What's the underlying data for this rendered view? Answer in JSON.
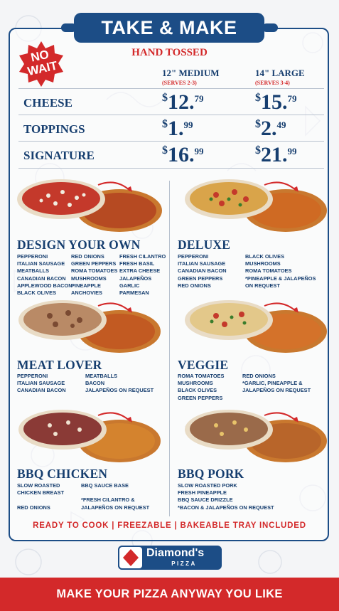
{
  "header": {
    "title": "TAKE & MAKE",
    "badge": "NO WAIT",
    "subtitle": "HAND TOSSED"
  },
  "sizes": [
    {
      "name": "12\" MEDIUM",
      "serves": "(SERVES 2-3)"
    },
    {
      "name": "14\" LARGE",
      "serves": "(SERVES 3-4)"
    }
  ],
  "prices": [
    {
      "label": "CHEESE",
      "medium": {
        "cur": "$",
        "whole": "12.",
        "cents": "79"
      },
      "large": {
        "cur": "$",
        "whole": "15.",
        "cents": "79"
      }
    },
    {
      "label": "TOPPINGS",
      "medium": {
        "cur": "$",
        "whole": "1.",
        "cents": "99"
      },
      "large": {
        "cur": "$",
        "whole": "2.",
        "cents": "49"
      }
    },
    {
      "label": "SIGNATURE",
      "medium": {
        "cur": "$",
        "whole": "16.",
        "cents": "99"
      },
      "large": {
        "cur": "$",
        "whole": "21.",
        "cents": "99"
      }
    }
  ],
  "pizzas": {
    "design": {
      "title": "DESIGN YOUR OWN",
      "col1": [
        "PEPPERONI",
        "ITALIAN SAUSAGE",
        "MEATBALLS",
        "CANADIAN BACON",
        "APPLEWOOD BACON",
        "BLACK OLIVES"
      ],
      "col2": [
        "RED ONIONS",
        "GREEN PEPPERS",
        "ROMA TOMATOES",
        "MUSHROOMS",
        "PINEAPPLE",
        "ANCHOVIES"
      ],
      "col3": [
        "FRESH CILANTRO",
        "FRESH BASIL",
        "EXTRA CHEESE",
        "JALAPEÑOS",
        "GARLIC",
        "PARMESAN"
      ]
    },
    "deluxe": {
      "title": "DELUXE",
      "col1": [
        "PEPPERONI",
        "ITALIAN SAUSAGE",
        "CANADIAN BACON",
        "GREEN PEPPERS",
        "RED ONIONS"
      ],
      "col2": [
        "BLACK OLIVES",
        "MUSHROOMS",
        "ROMA TOMATOES",
        "*PINEAPPLE & JALAPEÑOS",
        "ON REQUEST"
      ]
    },
    "meat": {
      "title": "MEAT LOVER",
      "col1": [
        "PEPPERONI",
        "ITALIAN SAUSAGE",
        "CANADIAN BACON"
      ],
      "col2": [
        "MEATBALLS",
        "BACON",
        "JALAPEÑOS ON REQUEST"
      ]
    },
    "veggie": {
      "title": "VEGGIE",
      "col1": [
        "ROMA TOMATOES",
        "MUSHROOMS",
        "BLACK OLIVES",
        "GREEN PEPPERS"
      ],
      "col2": [
        "RED ONIONS",
        "*GARLIC, PINEAPPLE &",
        "JALAPEÑOS ON REQUEST"
      ]
    },
    "bbqchicken": {
      "title": "BBQ CHICKEN",
      "col1": [
        "SLOW ROASTED",
        "CHICKEN BREAST",
        "",
        "RED ONIONS"
      ],
      "col2": [
        "BBQ SAUCE BASE",
        "",
        "*FRESH CILANTRO &",
        "JALAPEÑOS ON REQUEST"
      ]
    },
    "bbqpork": {
      "title": "BBQ PORK",
      "col1": [
        "SLOW ROASTED PORK",
        "FRESH PINEAPPLE",
        "BBQ SAUCE DRIZZLE",
        "*BACON & JALAPEÑOS ON REQUEST"
      ]
    }
  },
  "tagline": "READY TO COOK | FREEZABLE | BAKEABLE TRAY INCLUDED",
  "brand": {
    "name": "Diamond's",
    "sub": "PIZZA"
  },
  "footer": "MAKE YOUR PIZZA ANYWAY YOU LIKE",
  "colors": {
    "navy": "#1c4d86",
    "red": "#d3292a"
  }
}
